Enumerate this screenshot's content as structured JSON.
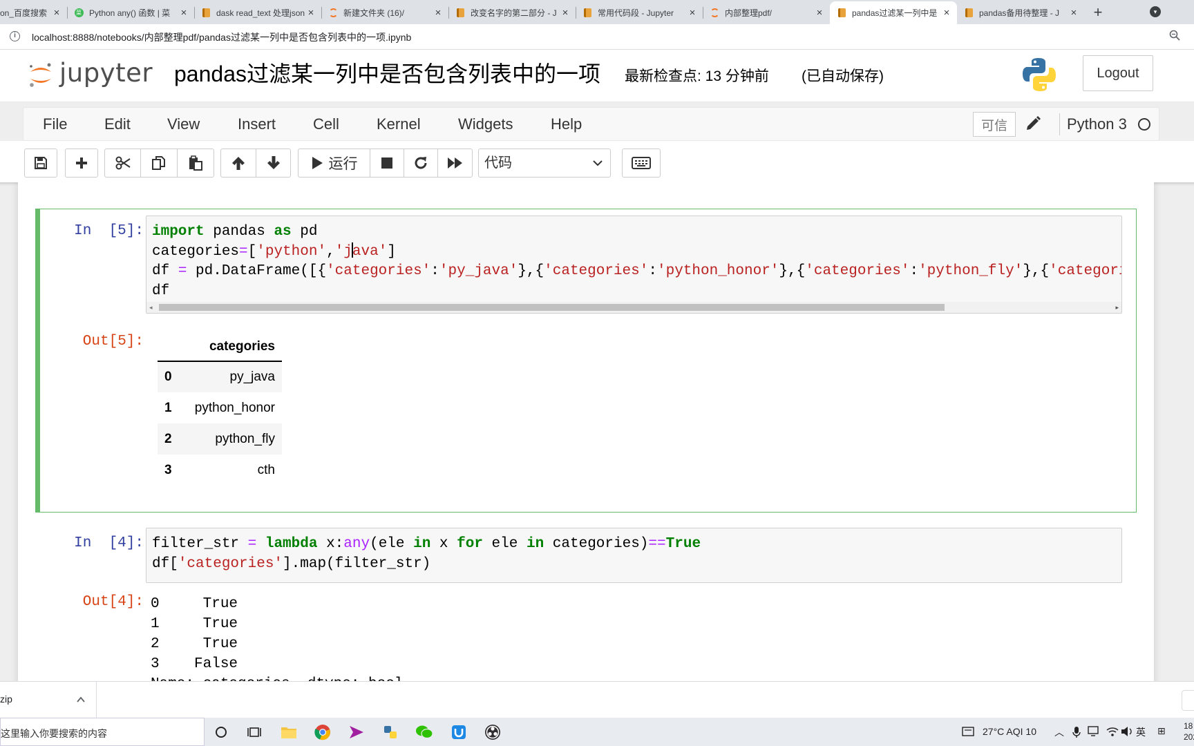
{
  "browser": {
    "tabs": [
      {
        "label": "on_百度搜索",
        "icon": "baidu-icon"
      },
      {
        "label": "Python any() 函数 | 菜",
        "icon": "runoob-icon"
      },
      {
        "label": "dask read_text 处理json",
        "icon": "notebook-icon"
      },
      {
        "label": "新建文件夹 (16)/",
        "icon": "jupyter-icon"
      },
      {
        "label": "改变名字的第二部分 - J",
        "icon": "notebook-icon"
      },
      {
        "label": "常用代码段 - Jupyter",
        "icon": "notebook-icon"
      },
      {
        "label": "内部整理pdf/",
        "icon": "jupyter-icon"
      },
      {
        "label": "pandas过滤某一列中是",
        "icon": "notebook-icon",
        "active": true
      },
      {
        "label": "pandas备用待整理 - J",
        "icon": "notebook-icon"
      }
    ],
    "new_tab": "+",
    "close_glyph": "×",
    "url": "localhost:8888/notebooks/内部整理pdf/pandas过滤某一列中是否包含列表中的一项.ipynb"
  },
  "jupyter": {
    "logo_text": "jupyter",
    "notebook_title": "pandas过滤某一列中是否包含列表中的一项",
    "checkpoint": "最新检查点: 13 分钟前",
    "autosave": "(已自动保存)",
    "logout": "Logout",
    "menu": [
      "File",
      "Edit",
      "View",
      "Insert",
      "Cell",
      "Kernel",
      "Widgets",
      "Help"
    ],
    "trusted": "可信",
    "kernel_name": "Python 3",
    "toolbar": {
      "run_label": "运行",
      "cell_type": "代码"
    }
  },
  "cells": {
    "cell1": {
      "in_prompt": "In  [5]:",
      "out_prompt": "Out[5]:",
      "table": {
        "header": "categories",
        "rows": [
          {
            "index": "0",
            "value": "py_java"
          },
          {
            "index": "1",
            "value": "python_honor"
          },
          {
            "index": "2",
            "value": "python_fly"
          },
          {
            "index": "3",
            "value": "cth"
          }
        ]
      }
    },
    "cell2": {
      "in_prompt": "In  [4]:",
      "out_prompt": "Out[4]:",
      "output_lines": [
        "0     True",
        "1     True",
        "2     True",
        "3    False",
        "Name: categories, dtype: bool"
      ]
    }
  },
  "downloads": {
    "item_name": "zip"
  },
  "taskbar": {
    "search_placeholder": "在这里输入你要搜索的内容",
    "weather": "27°C  AQI 10",
    "ime": "英",
    "time_fragment": "18",
    "date_fragment": "202"
  }
}
